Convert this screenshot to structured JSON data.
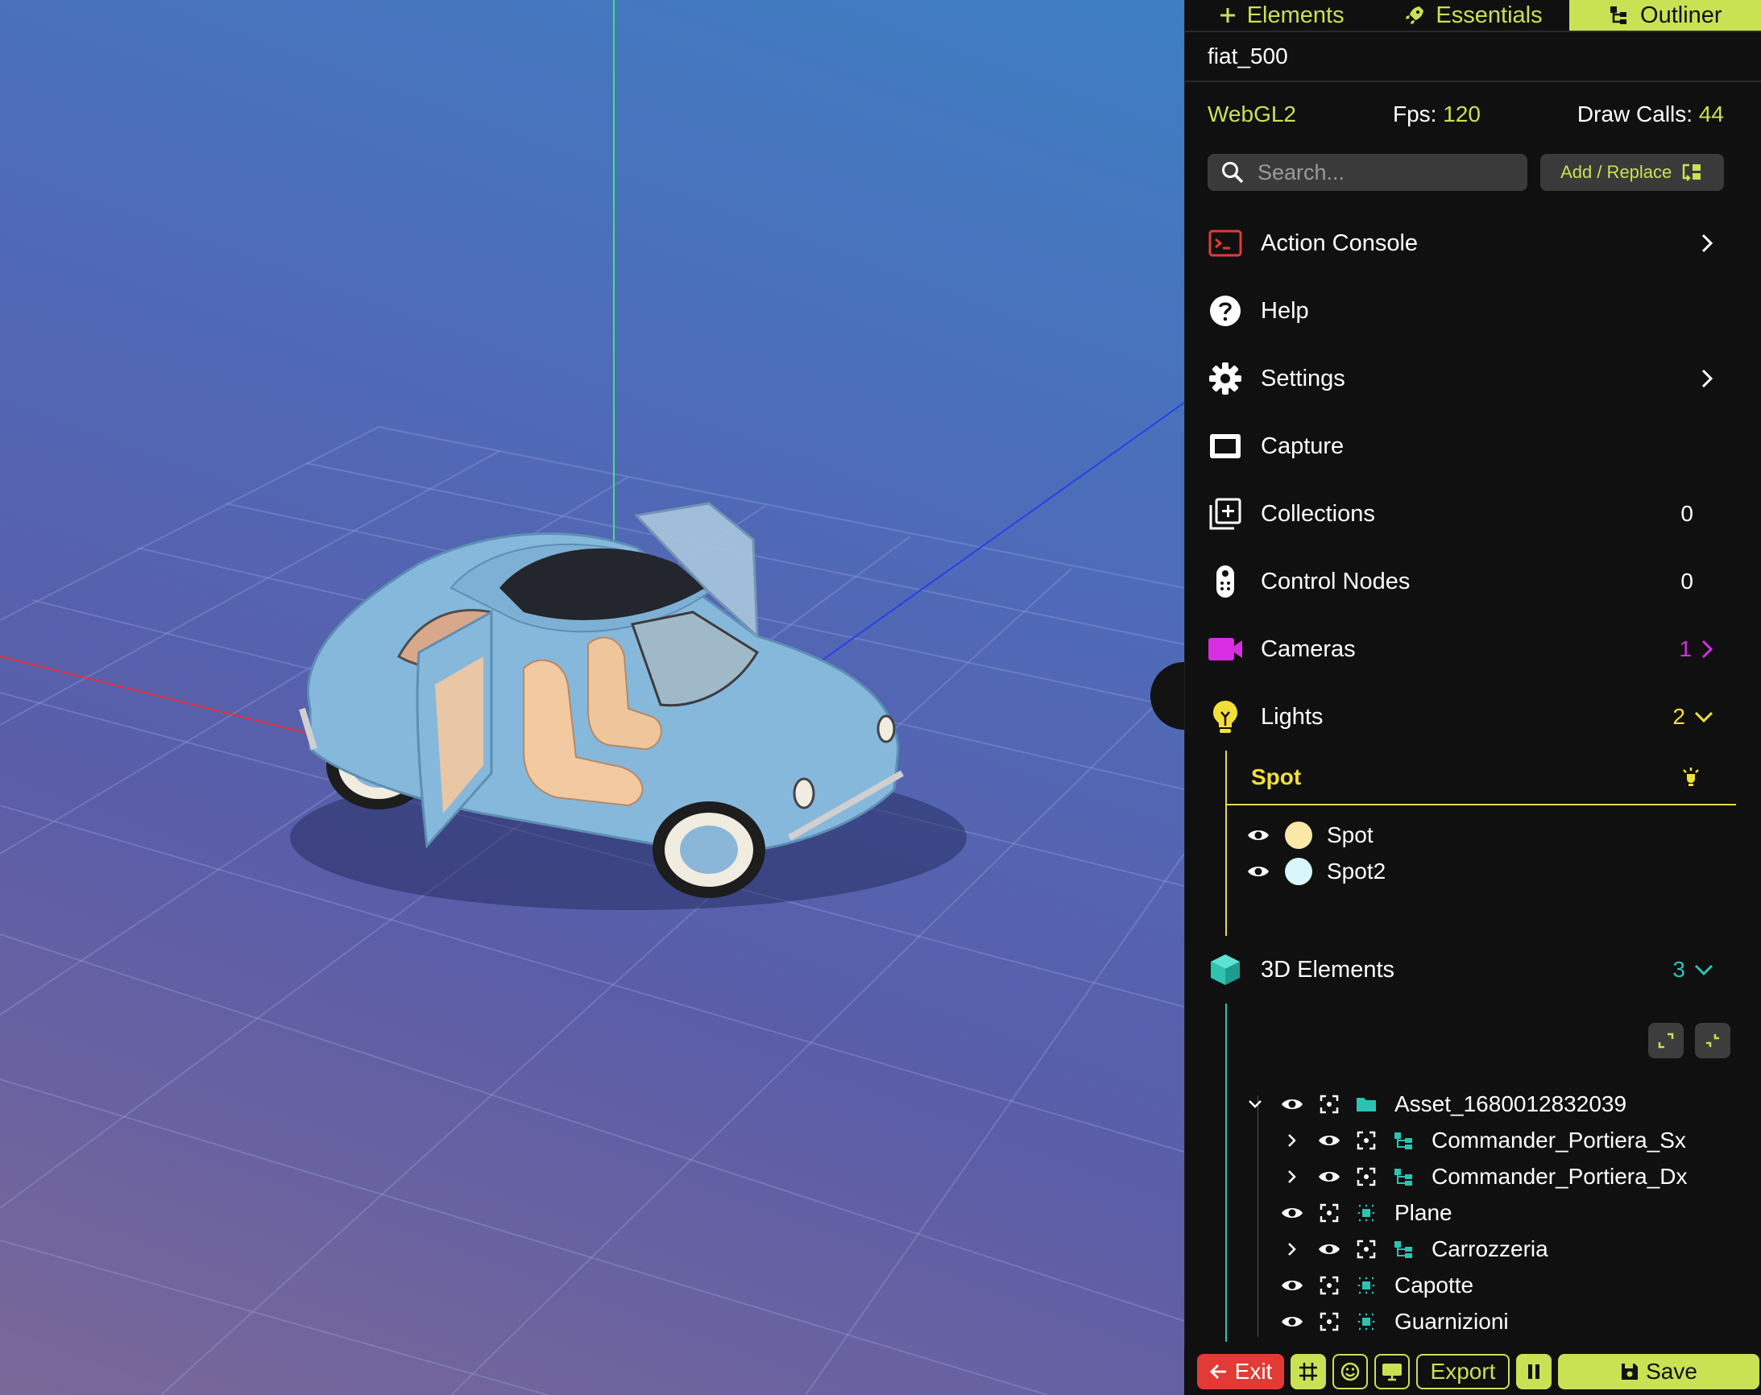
{
  "tabs": [
    {
      "label": "Elements",
      "icon": "plus-icon",
      "active": false
    },
    {
      "label": "Essentials",
      "icon": "rocket-icon",
      "active": false
    },
    {
      "label": "Outliner",
      "icon": "outliner-icon",
      "active": true
    }
  ],
  "project_name": "fiat_500",
  "stats": {
    "renderer": "WebGL2",
    "fps_label": "Fps:",
    "fps_value": "120",
    "draw_calls_label": "Draw Calls:",
    "draw_calls_value": "44"
  },
  "search": {
    "placeholder": "Search..."
  },
  "add_replace_label": "Add / Replace",
  "menu": {
    "action_console": "Action Console",
    "help": "Help",
    "settings": "Settings",
    "capture": "Capture",
    "collections": {
      "label": "Collections",
      "count": "0"
    },
    "control_nodes": {
      "label": "Control Nodes",
      "count": "0"
    },
    "cameras": {
      "label": "Cameras",
      "count": "1"
    },
    "lights": {
      "label": "Lights",
      "count": "2"
    },
    "elements_3d": {
      "label": "3D Elements",
      "count": "3"
    }
  },
  "lights": {
    "group": "Spot",
    "items": [
      {
        "name": "Spot",
        "color": "#fbe8a6"
      },
      {
        "name": "Spot2",
        "color": "#d8f6fb"
      }
    ]
  },
  "tree": {
    "root": "Asset_1680012832039",
    "children": [
      {
        "name": "Commander_Portiera_Sx",
        "type": "group",
        "expandable": true
      },
      {
        "name": "Commander_Portiera_Dx",
        "type": "group",
        "expandable": true
      },
      {
        "name": "Plane",
        "type": "mesh",
        "expandable": false
      },
      {
        "name": "Carrozzeria",
        "type": "group",
        "expandable": true
      },
      {
        "name": "Capotte",
        "type": "mesh",
        "expandable": false
      },
      {
        "name": "Guarnizioni",
        "type": "mesh",
        "expandable": false
      }
    ]
  },
  "bottombar": {
    "exit": "Exit",
    "export": "Export",
    "save": "Save"
  },
  "colors": {
    "accent": "#c8e253",
    "cameras": "#d62ee0",
    "lights": "#f3df3a",
    "elements": "#2cc3b3",
    "exit": "#e23b35",
    "action_console": "#e23b35"
  }
}
